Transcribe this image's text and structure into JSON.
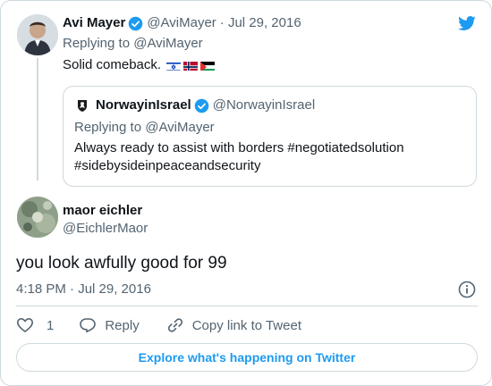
{
  "parent_tweet": {
    "author_name": "Avi Mayer",
    "author_handle": "@AviMayer",
    "date": "· Jul 29, 2016",
    "replying_to": "Replying to @AviMayer",
    "text": "Solid comeback.",
    "flags": [
      "israel-flag",
      "norway-flag",
      "palestine-flag"
    ]
  },
  "quoted_tweet": {
    "author_name": "NorwayinIsrael",
    "author_handle": "@NorwayinIsrael",
    "replying_to": "Replying to @AviMayer",
    "text_line1": "Always ready to assist with borders #negotiatedsolution",
    "text_line2": "#sidebysideinpeaceandsecurity"
  },
  "main_tweet": {
    "author_name": "maor eichler",
    "author_handle": "@EichlerMaor",
    "text": "you look awfully good for 99",
    "timestamp": "4:18 PM · Jul 29, 2016"
  },
  "actions": {
    "like_count": "1",
    "reply_label": "Reply",
    "copy_label": "Copy link to Tweet"
  },
  "explore_label": "Explore what's happening on Twitter",
  "colors": {
    "accent": "#1d9bf0",
    "text": "#0f1419",
    "muted": "#536471",
    "border": "#cfd9de"
  },
  "icons": [
    "twitter-bird-icon",
    "verified-badge-icon",
    "info-icon",
    "heart-icon",
    "reply-bubble-icon",
    "link-icon"
  ]
}
